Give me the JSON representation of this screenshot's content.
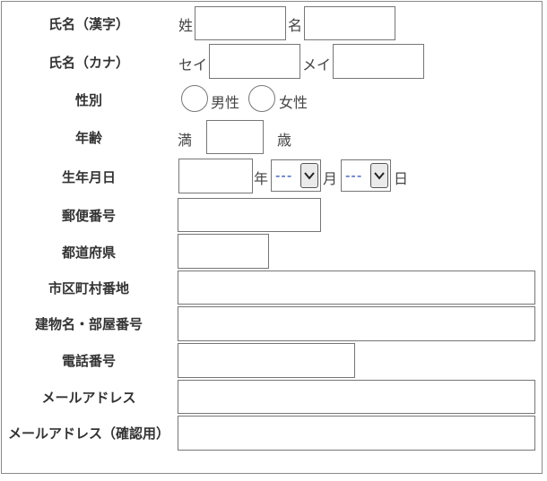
{
  "form": {
    "name_kanji": {
      "label": "氏名（漢字）",
      "sei": "姓",
      "mei": "名",
      "sei_value": "",
      "mei_value": ""
    },
    "name_kana": {
      "label": "氏名（カナ）",
      "sei": "セイ",
      "mei": "メイ",
      "sei_value": "",
      "mei_value": ""
    },
    "gender": {
      "label": "性別",
      "options": [
        "男性",
        "女性"
      ],
      "selected": null
    },
    "age": {
      "label": "年齢",
      "prefix": "満",
      "suffix": "歳",
      "value": ""
    },
    "birthday": {
      "label": "生年月日",
      "year_unit": "年",
      "month_unit": "月",
      "day_unit": "日",
      "year_value": "",
      "month_value": "---",
      "day_value": "---"
    },
    "postal": {
      "label": "郵便番号",
      "value": ""
    },
    "prefecture": {
      "label": "都道府県",
      "value": ""
    },
    "city": {
      "label": "市区町村番地",
      "value": ""
    },
    "building": {
      "label": "建物名・部屋番号",
      "value": ""
    },
    "phone": {
      "label": "電話番号",
      "value": ""
    },
    "email": {
      "label": "メールアドレス",
      "value": ""
    },
    "email_confirm": {
      "label": "メールアドレス（確認用）",
      "value": ""
    }
  },
  "colors": {
    "border": "#767676",
    "select_text": "#2244aa",
    "label": "#333333"
  }
}
